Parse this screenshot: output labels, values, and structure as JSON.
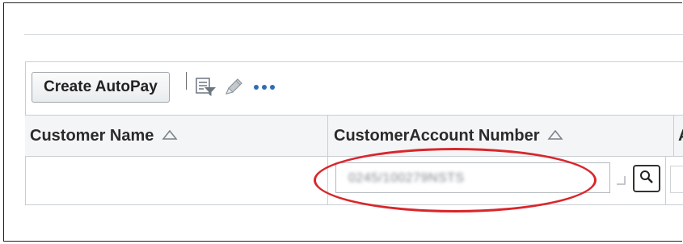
{
  "toolbar": {
    "create_label": "Create AutoPay",
    "icons": [
      "filter-icon",
      "pencil-icon",
      "more-icon"
    ]
  },
  "table": {
    "columns": [
      {
        "label": "Customer Name",
        "sort_icon": "sort-triangle-icon"
      },
      {
        "label": "CustomerAccount Number",
        "sort_icon": "sort-triangle-icon"
      },
      {
        "label": "A"
      }
    ],
    "filters": {
      "customer_account_number": "0245/100279NSTS"
    }
  },
  "colors": {
    "highlight": "#d9262b",
    "header_bg": "#f4f5f6",
    "border": "#c9ced3",
    "link_blue": "#2e6db4"
  }
}
